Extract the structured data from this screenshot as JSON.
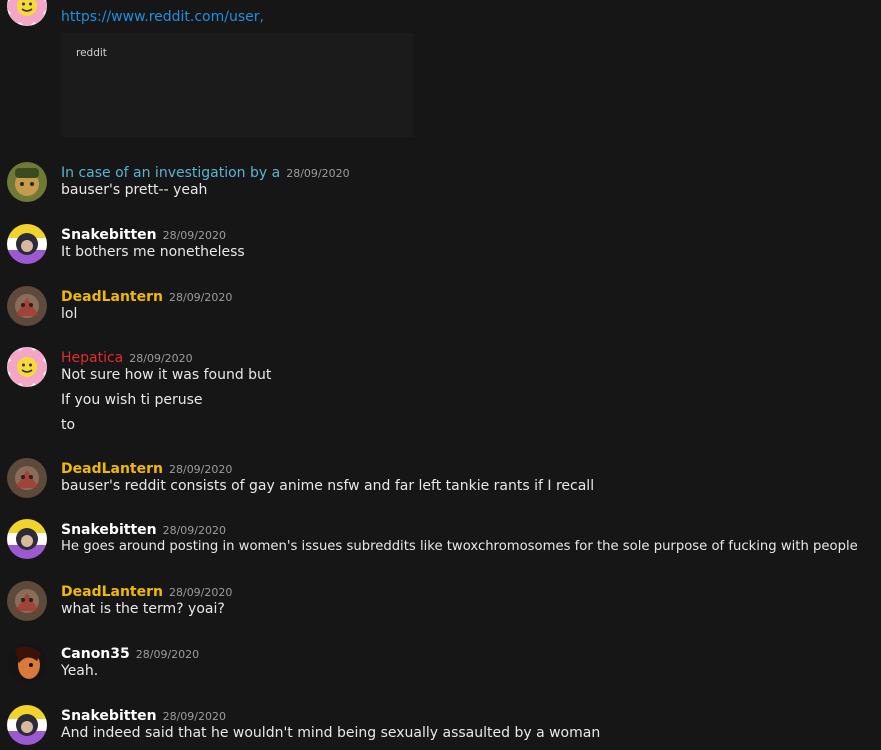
{
  "embed": {
    "link": "https://www.reddit.com/user,",
    "provider": "reddit"
  },
  "colors": {
    "background": "#161616",
    "link": "#1f8fe0",
    "user_default": "#ffffff",
    "user_teal": "#5ab4d2",
    "user_gold": "#f1b900",
    "user_red": "#e02c2c",
    "timestamp": "#9b9ca0"
  },
  "messages": [
    {
      "avatar": "character-avatar",
      "username": "In case of an investigation by a",
      "timestamp": "28/09/2020",
      "lines": [
        "bauser's prett-- yeah"
      ]
    },
    {
      "avatar": "snake-avatar",
      "username": "Snakebitten",
      "timestamp": "28/09/2020",
      "lines": [
        "It bothers me nonetheless"
      ]
    },
    {
      "avatar": "lantern-avatar",
      "username": "DeadLantern",
      "timestamp": "28/09/2020",
      "lines": [
        "lol"
      ]
    },
    {
      "avatar": "flower-avatar",
      "username": "Hepatica",
      "timestamp": "28/09/2020",
      "lines": [
        "Not sure how it was found but",
        "If you wish ti peruse",
        "to"
      ]
    },
    {
      "avatar": "lantern-avatar",
      "username": "DeadLantern",
      "timestamp": "28/09/2020",
      "lines": [
        "bauser's reddit consists of gay anime nsfw and far left tankie rants if I recall"
      ]
    },
    {
      "avatar": "snake-avatar",
      "username": "Snakebitten",
      "timestamp": "28/09/2020",
      "lines": [
        "He goes around posting in women's issues subreddits like twoxchromosomes for the sole purpose of fucking with people"
      ]
    },
    {
      "avatar": "lantern-avatar",
      "username": "DeadLantern",
      "timestamp": "28/09/2020",
      "lines": [
        "what is the term? yoai?"
      ]
    },
    {
      "avatar": "canon-avatar",
      "username": "Canon35",
      "timestamp": "28/09/2020",
      "lines": [
        "Yeah."
      ]
    },
    {
      "avatar": "snake-avatar",
      "username": "Snakebitten",
      "timestamp": "28/09/2020",
      "lines": [
        "And indeed said that he wouldn't mind being sexually assaulted by a woman"
      ]
    }
  ]
}
